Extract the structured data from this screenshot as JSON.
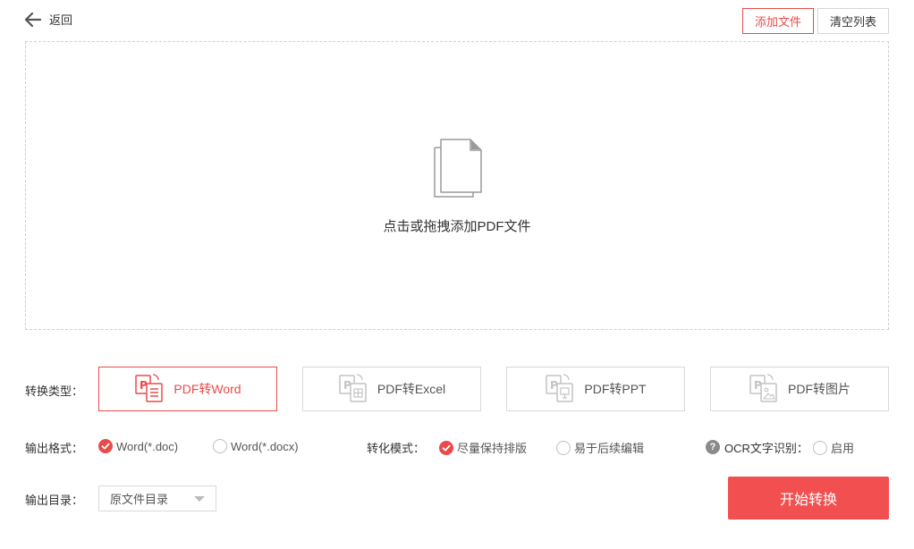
{
  "header": {
    "back_label": "返回",
    "add_file_label": "添加文件",
    "clear_list_label": "清空列表"
  },
  "dropzone": {
    "hint": "点击或拖拽添加PDF文件"
  },
  "conversion_type": {
    "label": "转换类型：",
    "options": [
      {
        "label": "PDF转Word",
        "icon": "word-doc-icon",
        "selected": true
      },
      {
        "label": "PDF转Excel",
        "icon": "excel-doc-icon",
        "selected": false
      },
      {
        "label": "PDF转PPT",
        "icon": "ppt-doc-icon",
        "selected": false
      },
      {
        "label": "PDF转图片",
        "icon": "image-doc-icon",
        "selected": false
      }
    ]
  },
  "output_format": {
    "label": "输出格式：",
    "options": [
      {
        "label": "Word(*.doc)",
        "checked": true
      },
      {
        "label": "Word(*.docx)",
        "checked": false
      }
    ]
  },
  "conversion_mode": {
    "label": "转化模式：",
    "options": [
      {
        "label": "尽量保持排版",
        "checked": true
      },
      {
        "label": "易于后续编辑",
        "checked": false
      }
    ]
  },
  "ocr": {
    "help_glyph": "?",
    "label": "OCR文字识别：",
    "enable_label": "启用",
    "enabled": false
  },
  "output_dir": {
    "label": "输出目录：",
    "selected": "原文件目录"
  },
  "start_button_label": "开始转换",
  "colors": {
    "accent": "#e94b4b",
    "start_button": "#f25050"
  }
}
